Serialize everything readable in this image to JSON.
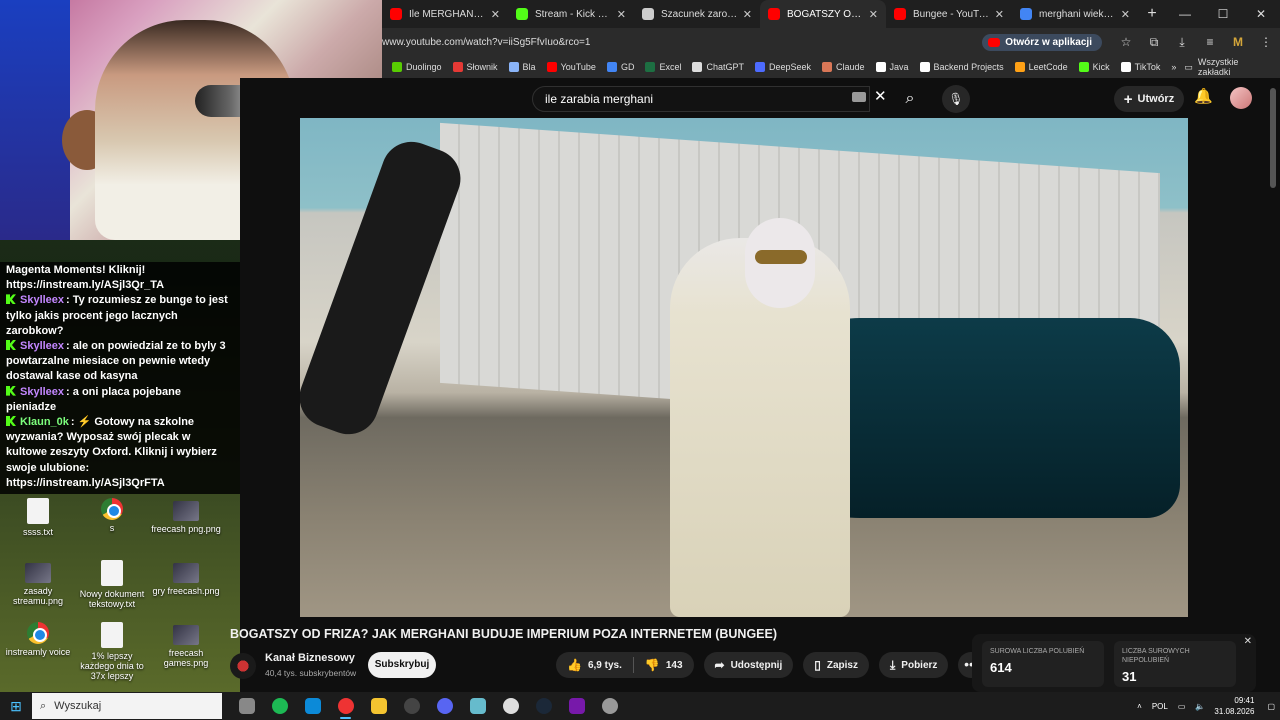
{
  "browser": {
    "tabs": [
      {
        "title": "Ile MERGHANI zarabia",
        "color": "#ff0000",
        "active": false
      },
      {
        "title": "Stream - Kick Dashboard",
        "color": "#53fc18",
        "active": false
      },
      {
        "title": "Szacunek zarobków Stream",
        "color": "#cccccc",
        "active": false
      },
      {
        "title": "BOGATSZY OD FRIZA",
        "color": "#ff0000",
        "active": true
      },
      {
        "title": "Bungee - YouTube",
        "color": "#ff0000",
        "active": false
      },
      {
        "title": "merghani wiek - Szukaj",
        "color": "#4285f4",
        "active": false
      }
    ],
    "new_tab": "+",
    "window_controls": [
      "—",
      "☐",
      "✕"
    ],
    "url": "www.youtube.com/watch?v=iiSg5FfvIuo&rco=1",
    "open_in_app": "Otwórz w aplikacji",
    "bookmarks": [
      {
        "label": "Duolingo",
        "color": "#58cc02"
      },
      {
        "label": "Słownik",
        "color": "#e53935"
      },
      {
        "label": "Bla",
        "color": "#8ab4f8"
      },
      {
        "label": "YouTube",
        "color": "#ff0000"
      },
      {
        "label": "GD",
        "color": "#4285f4"
      },
      {
        "label": "Excel",
        "color": "#1d6f42"
      },
      {
        "label": "ChatGPT",
        "color": "#dddddd"
      },
      {
        "label": "DeepSeek",
        "color": "#4d6bfe"
      },
      {
        "label": "Claude",
        "color": "#d97757"
      },
      {
        "label": "Java",
        "color": "#ffffff"
      },
      {
        "label": "Backend Projects",
        "color": "#ffffff"
      },
      {
        "label": "LeetCode",
        "color": "#ffa116"
      },
      {
        "label": "Kick",
        "color": "#53fc18"
      },
      {
        "label": "TikTok",
        "color": "#ffffff"
      }
    ],
    "all_bookmarks": "Wszystkie zakładki"
  },
  "youtube": {
    "search_value": "ile zarabia merghani",
    "create_label": "Utwórz",
    "video_title": "BOGATSZY OD FRIZA? JAK MERGHANI BUDUJE IMPERIUM POZA INTERNETEM (BUNGEE)",
    "channel_name": "Kanał Biznesowy",
    "channel_subs": "40,4 tys. subskrybentów",
    "subscribe_label": "Subskrybuj",
    "likes": "6,9 tys.",
    "dislikes": "143",
    "share_label": "Udostępnij",
    "save_label": "Zapisz",
    "download_label": "Pobierz",
    "more": "•••",
    "raw_likes_label": "SUROWA LICZBA POLUBIEŃ",
    "raw_likes_value": "614",
    "raw_dislikes_label": "LICZBA SUROWYCH NIEPOLUBIEŃ",
    "raw_dislikes_value": "31"
  },
  "chat": {
    "messages": [
      {
        "user": "",
        "text": "Magenta Moments! Kliknij! https://instream.ly/ASjl3Qr_TA"
      },
      {
        "user": "Skylleex",
        "text": "Ty rozumiesz ze bunge to jest tylko jakis procent jego lacznych zarobkow?"
      },
      {
        "user": "Skylleex",
        "text": "ale on powiedzial ze to byly 3 powtarzalne miesiace on pewnie wtedy dostawal kase od kasyna"
      },
      {
        "user": "Skylleex",
        "text": "a oni placa pojebane pieniadze"
      },
      {
        "user": "Klaun_0k",
        "text": "⚡ Gotowy na szkolne wyzwania? Wyposaż swój plecak w kultowe zeszyty Oxford. Kliknij i wybierz swoje ulubione: https://instream.ly/ASjl3QrFTA"
      }
    ]
  },
  "desktop": {
    "icons": [
      {
        "label": "ssss.txt",
        "kind": "doc"
      },
      {
        "label": "s",
        "kind": "chrome"
      },
      {
        "label": "freecash png.png",
        "kind": "img"
      },
      {
        "label": "zasady streamu.png",
        "kind": "img"
      },
      {
        "label": "Nowy dokument tekstowy.txt",
        "kind": "doc"
      },
      {
        "label": "gry freecash.png",
        "kind": "img"
      },
      {
        "label": "instreamly voice",
        "kind": "chrome"
      },
      {
        "label": "1% lepszy każdego dnia to 37x lepszy",
        "kind": "doc"
      },
      {
        "label": "freecash games.png",
        "kind": "img"
      }
    ]
  },
  "taskbar": {
    "search_placeholder": "Wyszukaj",
    "apps": [
      "task-view",
      "spotify",
      "edge",
      "chrome",
      "explorer",
      "obs",
      "discord",
      "notepad",
      "chatgpt",
      "steam",
      "onenote",
      "settings"
    ],
    "language": "POL",
    "time": "09:41",
    "date": "31.08.2026"
  }
}
